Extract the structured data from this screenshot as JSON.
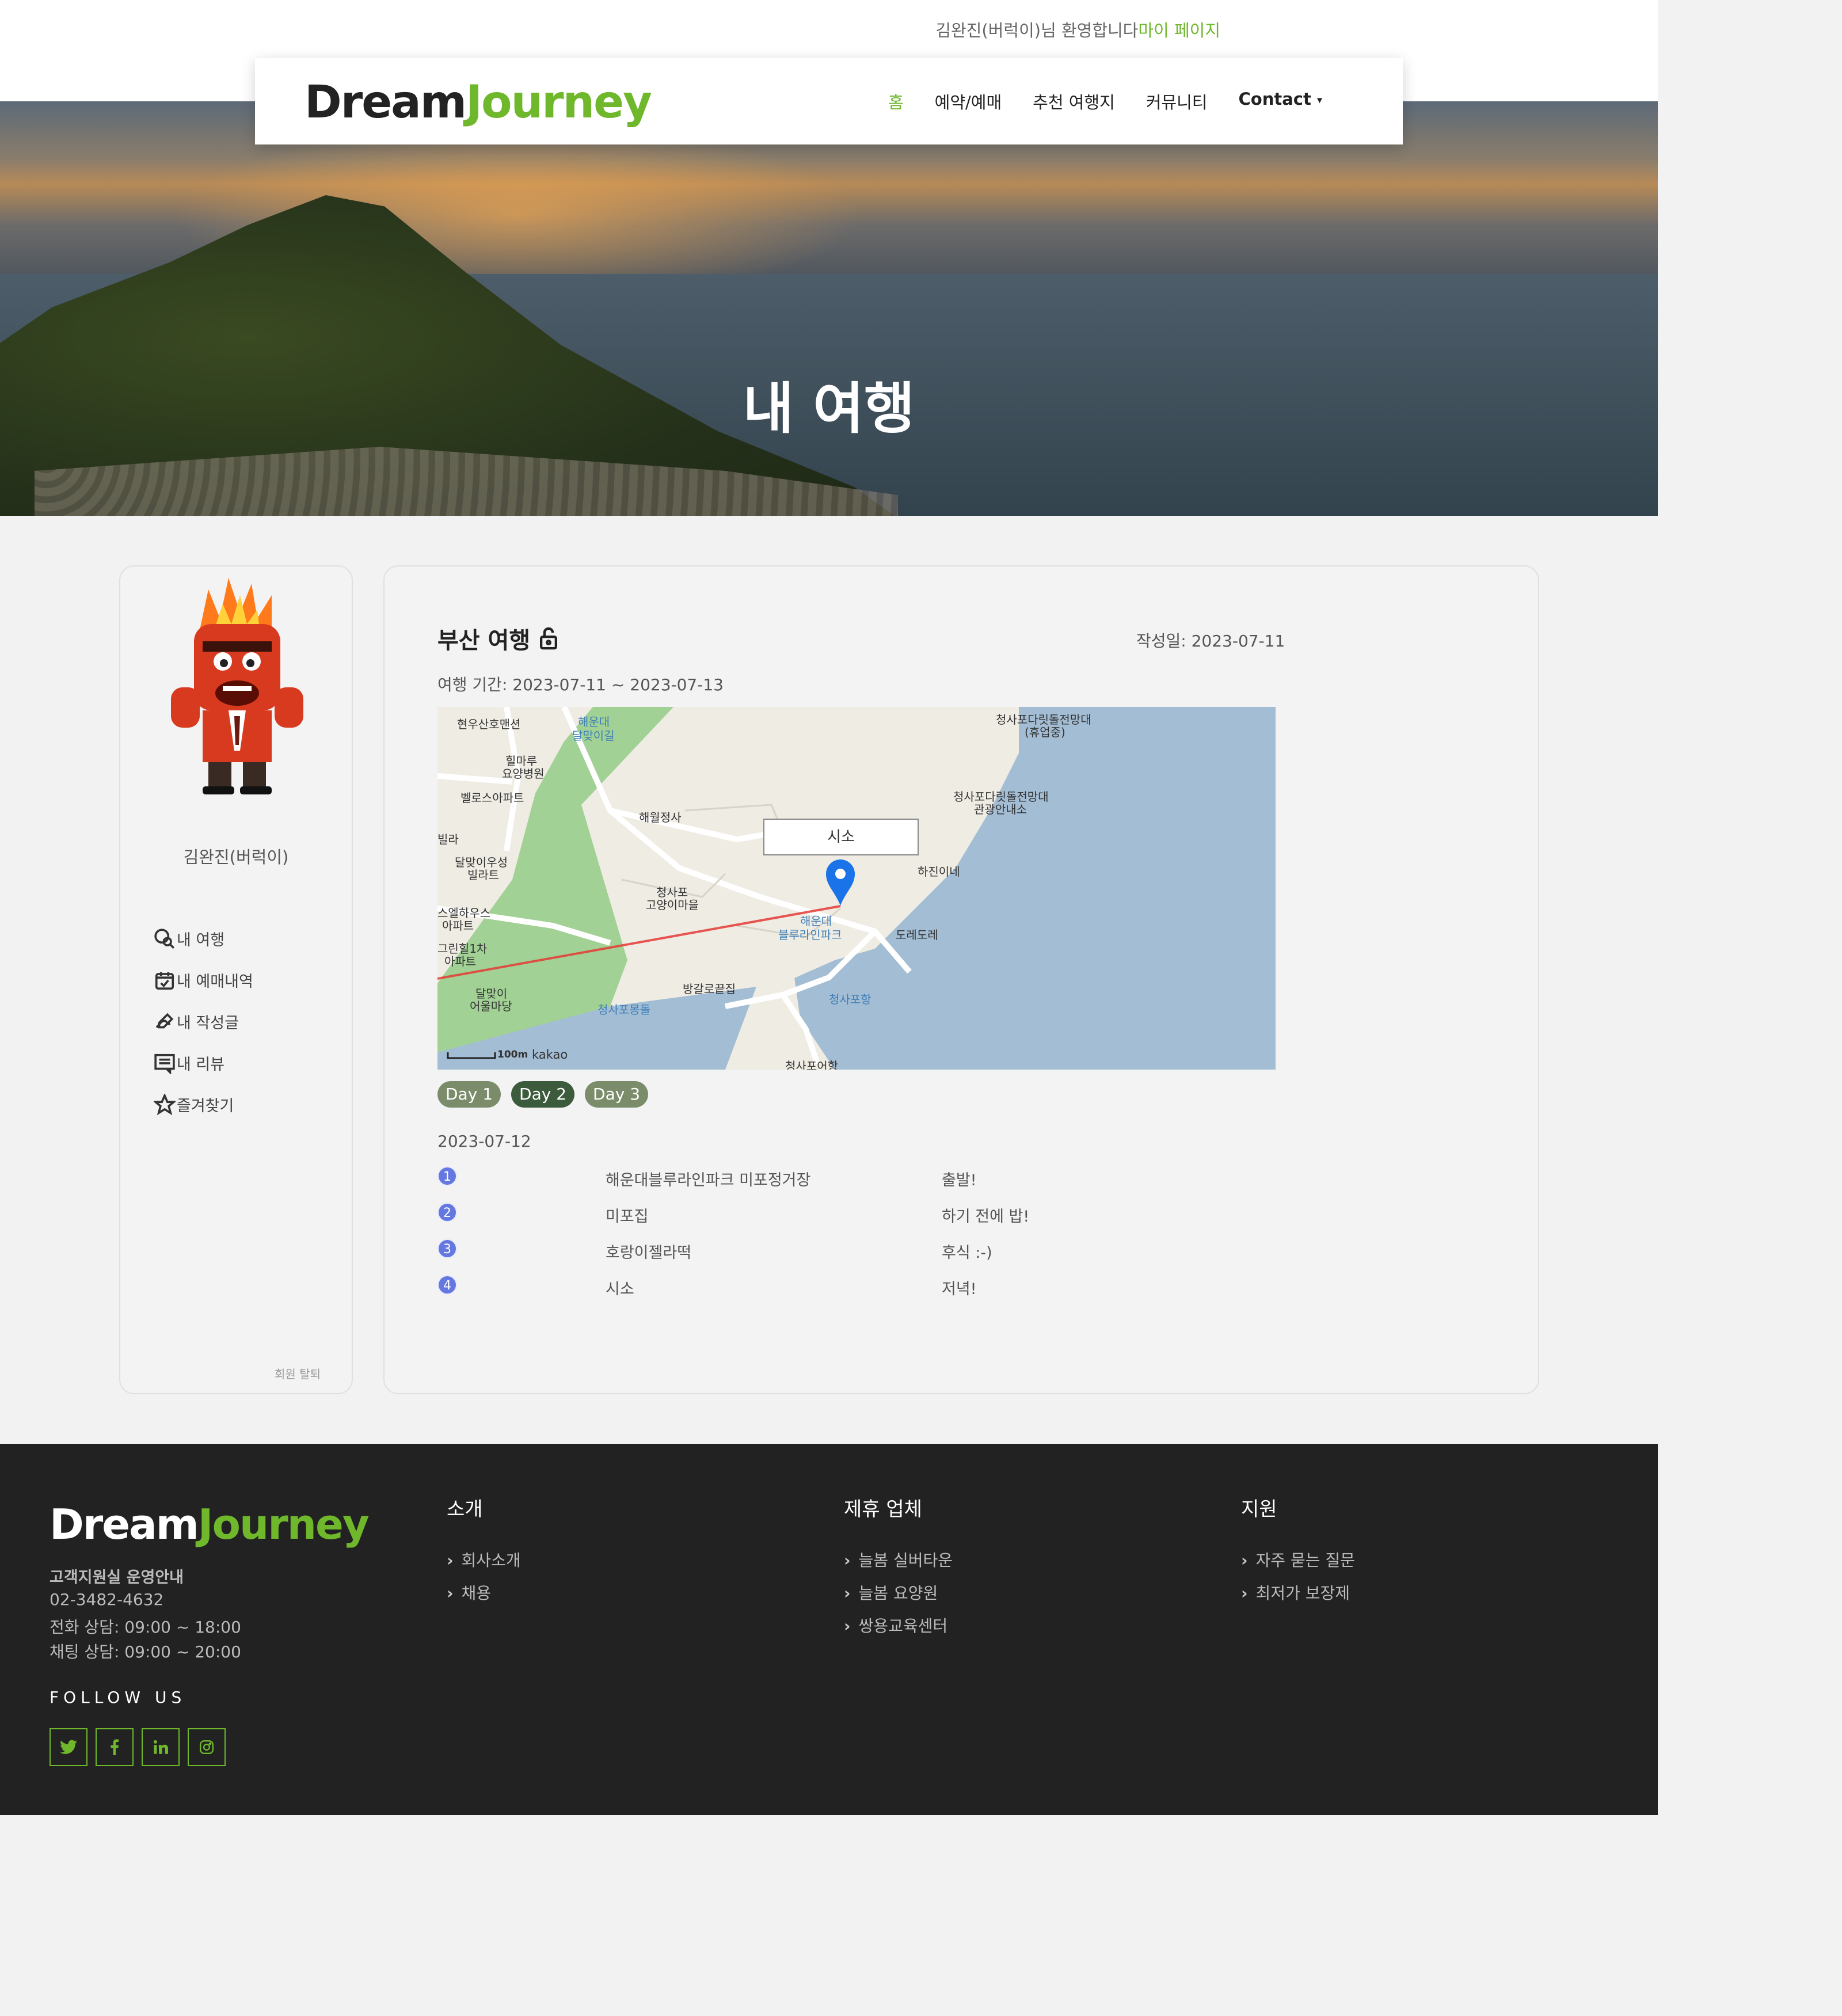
{
  "header": {
    "welcome_text": "김완진(버럭이)님 환영합니다",
    "mypage_link": "마이 페이지",
    "logo_part1": "Dream",
    "logo_part2": "Journey",
    "nav": {
      "home": "홈",
      "booking": "예약/예매",
      "recommend": "추천 여행지",
      "community": "커뮤니티",
      "contact": "Contact"
    }
  },
  "hero": {
    "title": "내 여행"
  },
  "sidebar": {
    "username": "김완진(버럭이)",
    "items": {
      "my_trip": "내 여행",
      "bookings": "내 예매내역",
      "posts": "내 작성글",
      "reviews": "내 리뷰",
      "favorites": "즐겨찾기"
    },
    "withdraw": "회원 탈퇴"
  },
  "trip": {
    "title": "부산 여행",
    "created": "작성일: 2023-07-11",
    "period": "여행 기간: 2023-07-11 ~ 2023-07-13",
    "map": {
      "info_window": "시소",
      "scale": "100m",
      "brand": "kakao",
      "labels": {
        "l1": "현우산호맨션",
        "l2": "해운대",
        "l3": "달맞이길",
        "l4": "힐마루",
        "l5": "요양병원",
        "l6": "벨로스아파트",
        "l7": "해월정사",
        "l8": "청사포다릿돌전망대",
        "l9": "(휴업중)",
        "l10": "청사포다릿돌전망대",
        "l11": "관광안내소",
        "l12": "하진이네",
        "l13": "달맞이우성",
        "l14": "빌라트",
        "l15": "청사포",
        "l16": "고양이마을",
        "l17": "해운대",
        "l18": "블루라인파크",
        "l19": "도레도레",
        "l20": "스엘하우스",
        "l21": "아파트",
        "l22": "그린힐1차",
        "l23": "아파트",
        "l24": "방갈로끝집",
        "l25": "달맞이",
        "l26": "어울마당",
        "l27": "청사포몽돌",
        "l28": "청사포항",
        "l29": "청사포어항",
        "l30": "빌라"
      }
    },
    "days": [
      "Day 1",
      "Day 2",
      "Day 3"
    ],
    "active_day": "Day 2",
    "day_date": "2023-07-12",
    "itinerary": [
      {
        "num": "1",
        "place": "해운대블루라인파크 미포정거장",
        "memo": "출발!"
      },
      {
        "num": "2",
        "place": "미포집",
        "memo": "하기 전에 밥!"
      },
      {
        "num": "3",
        "place": "호랑이젤라떡",
        "memo": "후식 :-)"
      },
      {
        "num": "4",
        "place": "시소",
        "memo": "저녁!"
      }
    ]
  },
  "footer": {
    "logo_part1": "Dream",
    "logo_part2": "Journey",
    "hours_title": "고객지원실 운영안내",
    "phone": "02-3482-4632",
    "call_hours": "전화 상담: 09:00 ~ 18:00",
    "chat_hours": "채팅 상담: 09:00 ~ 20:00",
    "follow": "FOLLOW US",
    "socials": [
      "twitter-icon",
      "facebook-icon",
      "linkedin-icon",
      "instagram-icon"
    ],
    "col1": {
      "title": "소개",
      "links": [
        "회사소개",
        "채용"
      ]
    },
    "col2": {
      "title": "제휴 업체",
      "links": [
        "늘봄 실버타운",
        "늘봄 요양원",
        "쌍용교육센터"
      ]
    },
    "col3": {
      "title": "지원",
      "links": [
        "자주 묻는 질문",
        "최저가 보장제"
      ]
    }
  },
  "colors": {
    "accent": "#6fb72b",
    "footer_bg": "#222222",
    "marker": "#1a73e8",
    "route": "#e53935"
  }
}
